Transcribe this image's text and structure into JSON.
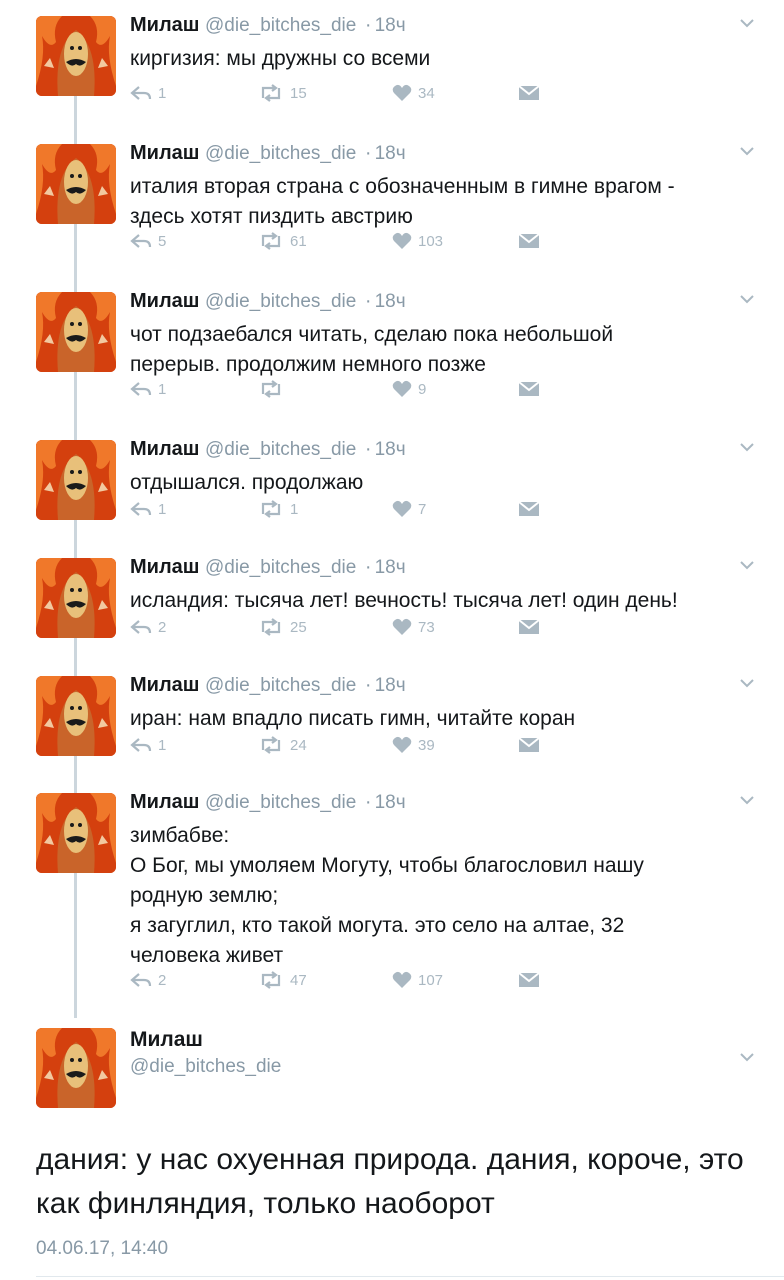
{
  "colors": {
    "accent": "#1da1f2",
    "muted": "#8899a6",
    "icon": "#aab8c2",
    "text": "#14171a",
    "thread": "#ccd6dd"
  },
  "author": {
    "name": "Милаш",
    "handle": "@die_bitches_die",
    "avatar_icon": "avatar-icon"
  },
  "tweets": [
    {
      "time": "18ч",
      "text": "киргизия: мы дружны со всеми",
      "replies": "1",
      "retweets": "15",
      "likes": "34"
    },
    {
      "time": "18ч",
      "text": "италия вторая страна с обозначенным в гимне врагом -\nздесь хотят пиздить австрию",
      "replies": "5",
      "retweets": "61",
      "likes": "103"
    },
    {
      "time": "18ч",
      "text": "чот подзаебался читать, сделаю пока небольшой\nперерыв. продолжим немного позже",
      "replies": "1",
      "retweets": "",
      "likes": "9"
    },
    {
      "time": "18ч",
      "text": "отдышался. продолжаю",
      "replies": "1",
      "retweets": "1",
      "likes": "7"
    },
    {
      "time": "18ч",
      "text": "исландия: тысяча лет! вечность! тысяча лет! один день!",
      "replies": "2",
      "retweets": "25",
      "likes": "73"
    },
    {
      "time": "18ч",
      "text": "иран: нам впадло писать гимн, читайте коран",
      "replies": "1",
      "retweets": "24",
      "likes": "39"
    },
    {
      "time": "18ч",
      "text": "зимбабве:\nО Бог, мы умоляем Могуту, чтобы благословил нашу\nродную землю;\nя загуглил, кто такой могута. это село на алтае, 32\nчеловека живет",
      "replies": "2",
      "retweets": "47",
      "likes": "107"
    }
  ],
  "main_tweet": {
    "name": "Милаш",
    "handle": "@die_bitches_die",
    "text": "дания: у нас охуенная природа. дания, короче, это как финляндия, только наоборот",
    "date": "04.06.17, 14:40"
  }
}
